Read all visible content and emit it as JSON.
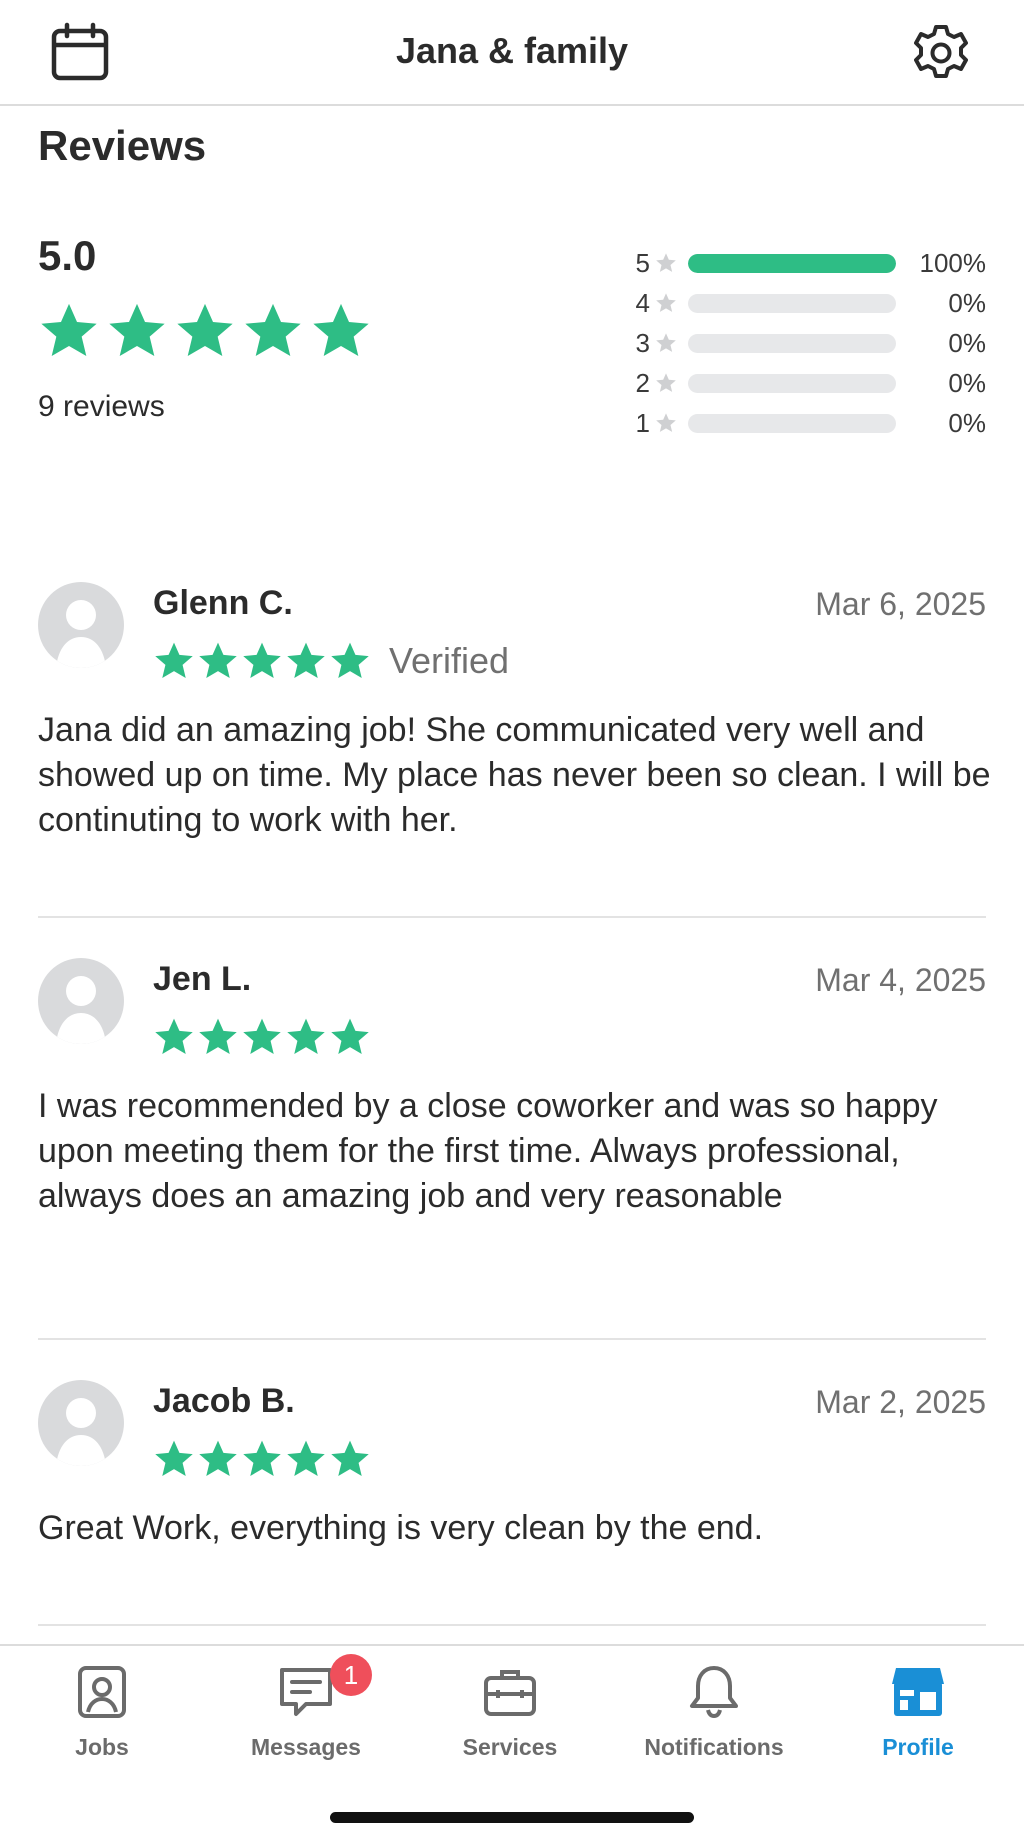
{
  "header": {
    "title": "Jana & family",
    "calendar_icon": "calendar-icon",
    "settings_icon": "gear-icon"
  },
  "reviews_section": {
    "heading": "Reviews",
    "average": "5.0",
    "rating_stars": 5,
    "review_count": "9 reviews",
    "distribution": [
      {
        "star": "5",
        "percent": "100%",
        "fraction": 1.0
      },
      {
        "star": "4",
        "percent": "0%",
        "fraction": 0
      },
      {
        "star": "3",
        "percent": "0%",
        "fraction": 0
      },
      {
        "star": "2",
        "percent": "0%",
        "fraction": 0
      },
      {
        "star": "1",
        "percent": "0%",
        "fraction": 0
      }
    ]
  },
  "reviews": [
    {
      "name": "Glenn C.",
      "date": "Mar 6, 2025",
      "stars": 5,
      "verified": "Verified",
      "text": "Jana did an amazing job! She communicated very well and showed up on time. My place has never been so clean. I will be continuting to work with her."
    },
    {
      "name": "Jen L.",
      "date": "Mar 4, 2025",
      "stars": 5,
      "text": "I was recommended by a close coworker and was so happy upon meeting them for the first time. Always professional, always does an amazing job and very reasonable"
    },
    {
      "name": "Jacob B.",
      "date": "Mar 2, 2025",
      "stars": 5,
      "text": "Great Work, everything is very clean by the end."
    }
  ],
  "tabbar": {
    "items": [
      {
        "label": "Jobs",
        "icon": "jobs-icon"
      },
      {
        "label": "Messages",
        "icon": "messages-icon",
        "badge": "1"
      },
      {
        "label": "Services",
        "icon": "briefcase-icon"
      },
      {
        "label": "Notifications",
        "icon": "bell-icon"
      },
      {
        "label": "Profile",
        "icon": "storefront-icon",
        "active": true
      }
    ]
  },
  "colors": {
    "star_green": "#2ebd85",
    "active_blue": "#1a8fd6",
    "badge_red": "#ef4f5b",
    "track_gray": "#e7e8ea"
  }
}
